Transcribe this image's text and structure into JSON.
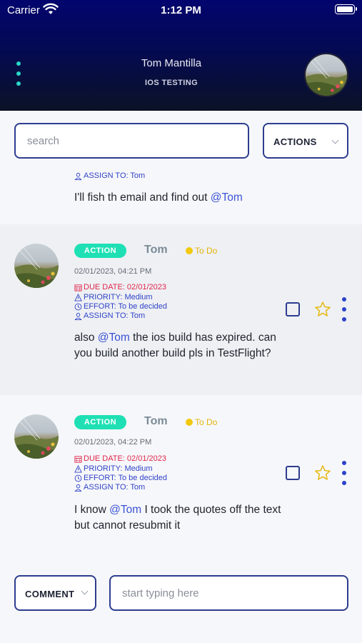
{
  "status_bar": {
    "carrier": "Carrier",
    "time": "1:12 PM"
  },
  "header": {
    "title": "Tom Mantilla",
    "subtitle": "IOS TESTING"
  },
  "search": {
    "placeholder": "search"
  },
  "actions": {
    "label": "ACTIONS"
  },
  "messages": [
    {
      "assign": "ASSIGN TO: Tom",
      "text_before": "I'll fish th email and find out ",
      "mention": "@Tom",
      "text_after": ""
    },
    {
      "badge": "ACTION",
      "author": "Tom",
      "status": "To Do",
      "time": "02/01/2023, 04:21 PM",
      "due": "DUE DATE: 02/01/2023",
      "priority": "PRIORITY: Medium",
      "effort": "EFFORT: To be decided",
      "assign": "ASSIGN TO: Tom",
      "text_before": "also ",
      "mention": "@Tom",
      "text_after": " the ios build has expired. can you build another build pls in TestFlight?"
    },
    {
      "badge": "ACTION",
      "author": "Tom",
      "status": "To Do",
      "time": "02/01/2023, 04:22 PM",
      "due": "DUE DATE: 02/01/2023",
      "priority": "PRIORITY: Medium",
      "effort": "EFFORT: To be decided",
      "assign": "ASSIGN TO: Tom",
      "text_before": "I know ",
      "mention": "@Tom",
      "text_after": " I took the quotes off the text but cannot resubmit it"
    }
  ],
  "composer": {
    "comment_label": "COMMENT",
    "placeholder": "start typing here"
  },
  "colors": {
    "accent": "#2d3d8f",
    "badge": "#1ee0b4",
    "due": "#e0264a",
    "mention": "#3a52d6",
    "status_dot": "#f2c90f"
  }
}
